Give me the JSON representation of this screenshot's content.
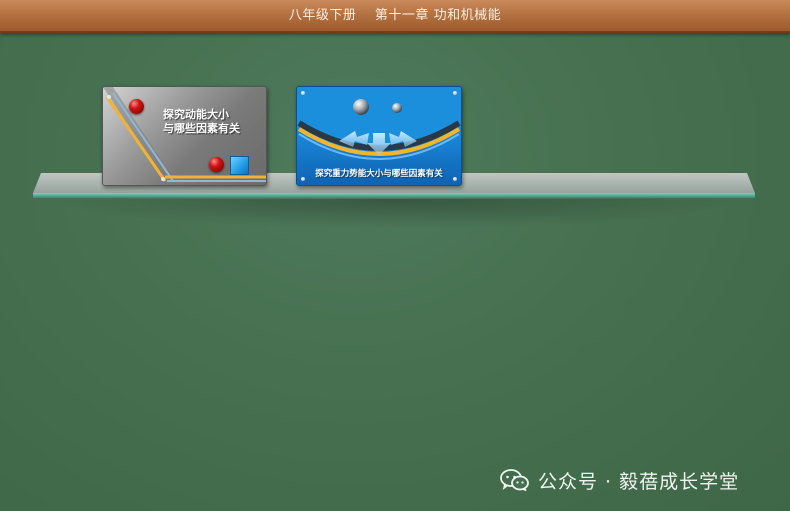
{
  "header": {
    "title": "八年级下册    第十一章 功和机械能"
  },
  "shelf": {
    "cards": [
      {
        "title": "探究动能大小\n与哪些因素有关"
      },
      {
        "title": "探究重力势能大小与哪些因素有关"
      }
    ]
  },
  "watermark": {
    "text": "公众号 · 毅蓓成长学堂",
    "icon": "wechat-icon"
  },
  "colors": {
    "background": "#46704f",
    "header": "#b3703f",
    "card_blue": "#1a86d6"
  }
}
